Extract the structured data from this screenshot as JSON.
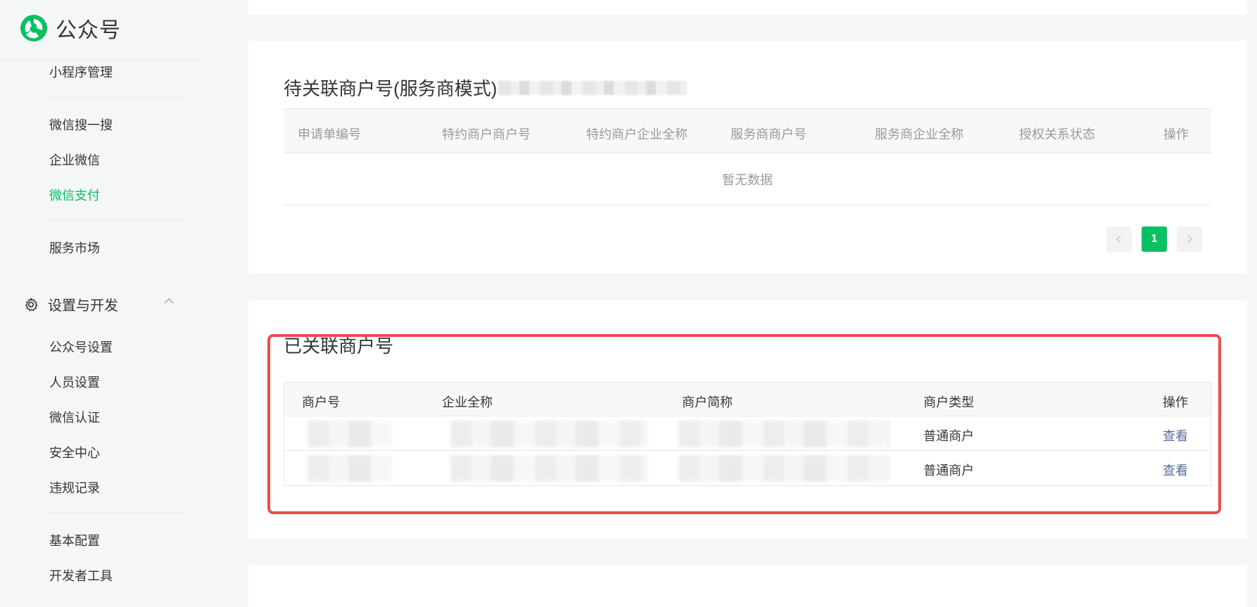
{
  "brand": {
    "name": "公众号"
  },
  "sidebar": {
    "items": [
      {
        "label": "小程序管理"
      },
      {
        "label": "微信搜一搜"
      },
      {
        "label": "企业微信"
      },
      {
        "label": "微信支付",
        "active": true
      },
      {
        "label": "服务市场"
      }
    ],
    "group": {
      "label": "设置与开发",
      "icon": "gear-icon"
    },
    "group_items": [
      {
        "label": "公众号设置"
      },
      {
        "label": "人员设置"
      },
      {
        "label": "微信认证"
      },
      {
        "label": "安全中心"
      },
      {
        "label": "违规记录"
      },
      {
        "label": "基本配置"
      },
      {
        "label": "开发者工具"
      }
    ]
  },
  "pending": {
    "title": "待关联商户号(服务商模式)",
    "columns": [
      "申请单编号",
      "特约商户商户号",
      "特约商户企业全称",
      "服务商商户号",
      "服务商企业全称",
      "授权关系状态",
      "操作"
    ],
    "empty_text": "暂无数据",
    "pagination": {
      "current": "1"
    }
  },
  "linked": {
    "title": "已关联商户号",
    "columns": [
      "商户号",
      "企业全称",
      "商户简称",
      "商户类型",
      "操作"
    ],
    "rows": [
      {
        "type": "普通商户",
        "action": "查看"
      },
      {
        "type": "普通商户",
        "action": "查看"
      }
    ]
  },
  "colors": {
    "accent": "#07c160",
    "link": "#576b95",
    "highlight": "#e94e4e"
  }
}
